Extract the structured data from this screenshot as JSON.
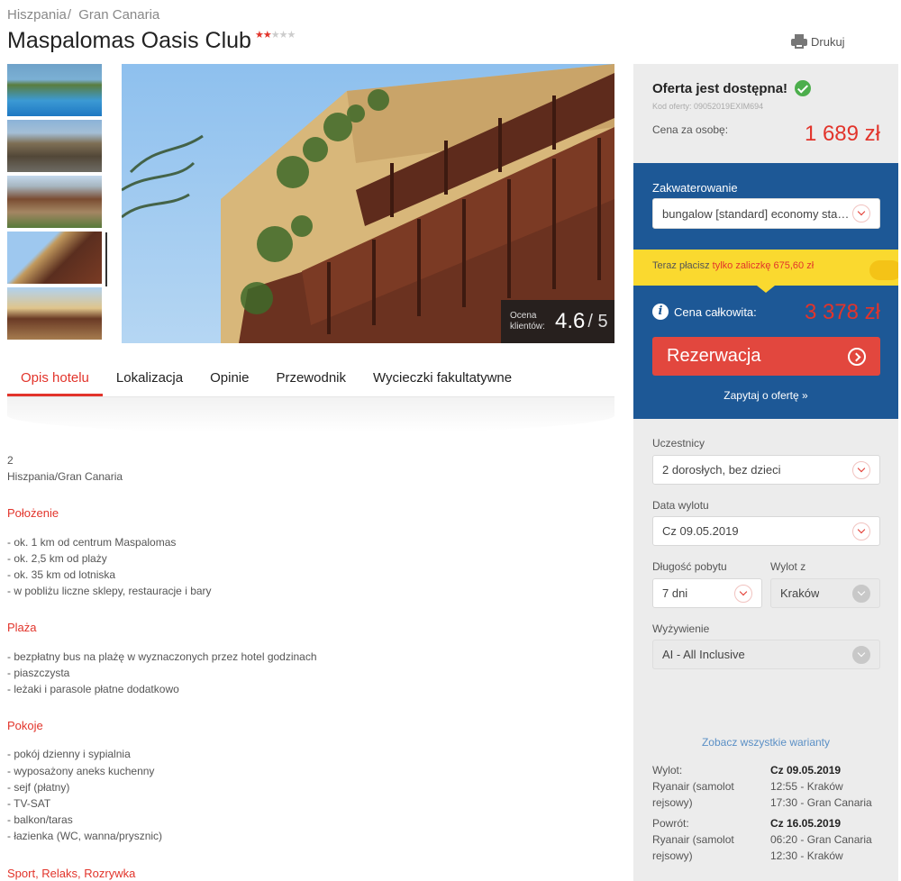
{
  "breadcrumb": {
    "country": "Hiszpania",
    "region": "Gran Canaria",
    "separator": "/"
  },
  "hotel": {
    "name": "Maspalomas Oasis Club",
    "stars": 2,
    "max_stars": 5,
    "star_on": "★",
    "star_off": "★"
  },
  "print_label": "Drukuj",
  "rating": {
    "label": "Ocena klientów:",
    "value": "4.6",
    "max": "/ 5"
  },
  "tabs": [
    {
      "label": "Opis hotelu",
      "active": true
    },
    {
      "label": "Lokalizacja",
      "active": false
    },
    {
      "label": "Opinie",
      "active": false
    },
    {
      "label": "Przewodnik",
      "active": false
    },
    {
      "label": "Wycieczki fakultatywne",
      "active": false
    }
  ],
  "content": {
    "intro_stars": "2",
    "intro_location": "Hiszpania/Gran Canaria",
    "sections": [
      {
        "title": "Położenie",
        "lines": [
          "- ok. 1 km od centrum Maspalomas",
          "- ok. 2,5 km od plaży",
          "- ok. 35 km od lotniska",
          "- w pobliżu liczne sklepy, restauracje i bary"
        ]
      },
      {
        "title": "Plaża",
        "lines": [
          "- bezpłatny bus na plażę w wyznaczonych przez hotel godzinach",
          "- piaszczysta",
          "- leżaki i parasole płatne dodatkowo"
        ]
      },
      {
        "title": "Pokoje",
        "lines": [
          "- pokój dzienny i sypialnia",
          "- wyposażony aneks kuchenny",
          "- sejf (płatny)",
          "- TV-SAT",
          "- balkon/taras",
          "- łazienka (WC, wanna/prysznic)"
        ]
      },
      {
        "title": "Sport, Relaks, Rozrywka",
        "lines": []
      }
    ]
  },
  "sidebar": {
    "availability": "Oferta jest dostępna!",
    "offer_code": "Kod oferty: 09052019EXIM694",
    "price_person_label": "Cena za osobę:",
    "price_person": "1 689 zł",
    "accommodation_label": "Zakwaterowanie",
    "accommodation_value": "bungalow [standard] economy standard",
    "deposit_prefix": "Teraz płacisz",
    "deposit_highlight": "tylko zaliczkę 675,60 zł",
    "total_label": "Cena całkowita:",
    "total_price": "3 378 zł",
    "reserve_button": "Rezerwacja",
    "ask_link": "Zapytaj o ofertę »",
    "participants_label": "Uczestnicy",
    "participants_value": "2 dorosłych, bez dzieci",
    "departure_date_label": "Data wylotu",
    "departure_date_value": "Cz 09.05.2019",
    "stay_length_label": "Długość pobytu",
    "stay_length_value": "7 dni",
    "departure_from_label": "Wylot z",
    "departure_from_value": "Kraków",
    "board_label": "Wyżywienie",
    "board_value": "AI - All Inclusive",
    "variants_link": "Zobacz wszystkie warianty",
    "outbound": {
      "label": "Wylot:",
      "airline": "Ryanair (samolot rejsowy)",
      "date": "Cz 09.05.2019",
      "dep": "12:55 - Kraków",
      "arr": "17:30 - Gran Canaria"
    },
    "return": {
      "label": "Powrót:",
      "airline": "Ryanair (samolot rejsowy)",
      "date": "Cz 16.05.2019",
      "dep": "06:20 - Gran Canaria",
      "arr": "12:30 - Kraków"
    }
  },
  "colors": {
    "accent": "#e2342b",
    "blue": "#1d5896",
    "yellow": "#fad92f",
    "sidebar_bg": "#ececec",
    "link": "#5a8fc5"
  }
}
